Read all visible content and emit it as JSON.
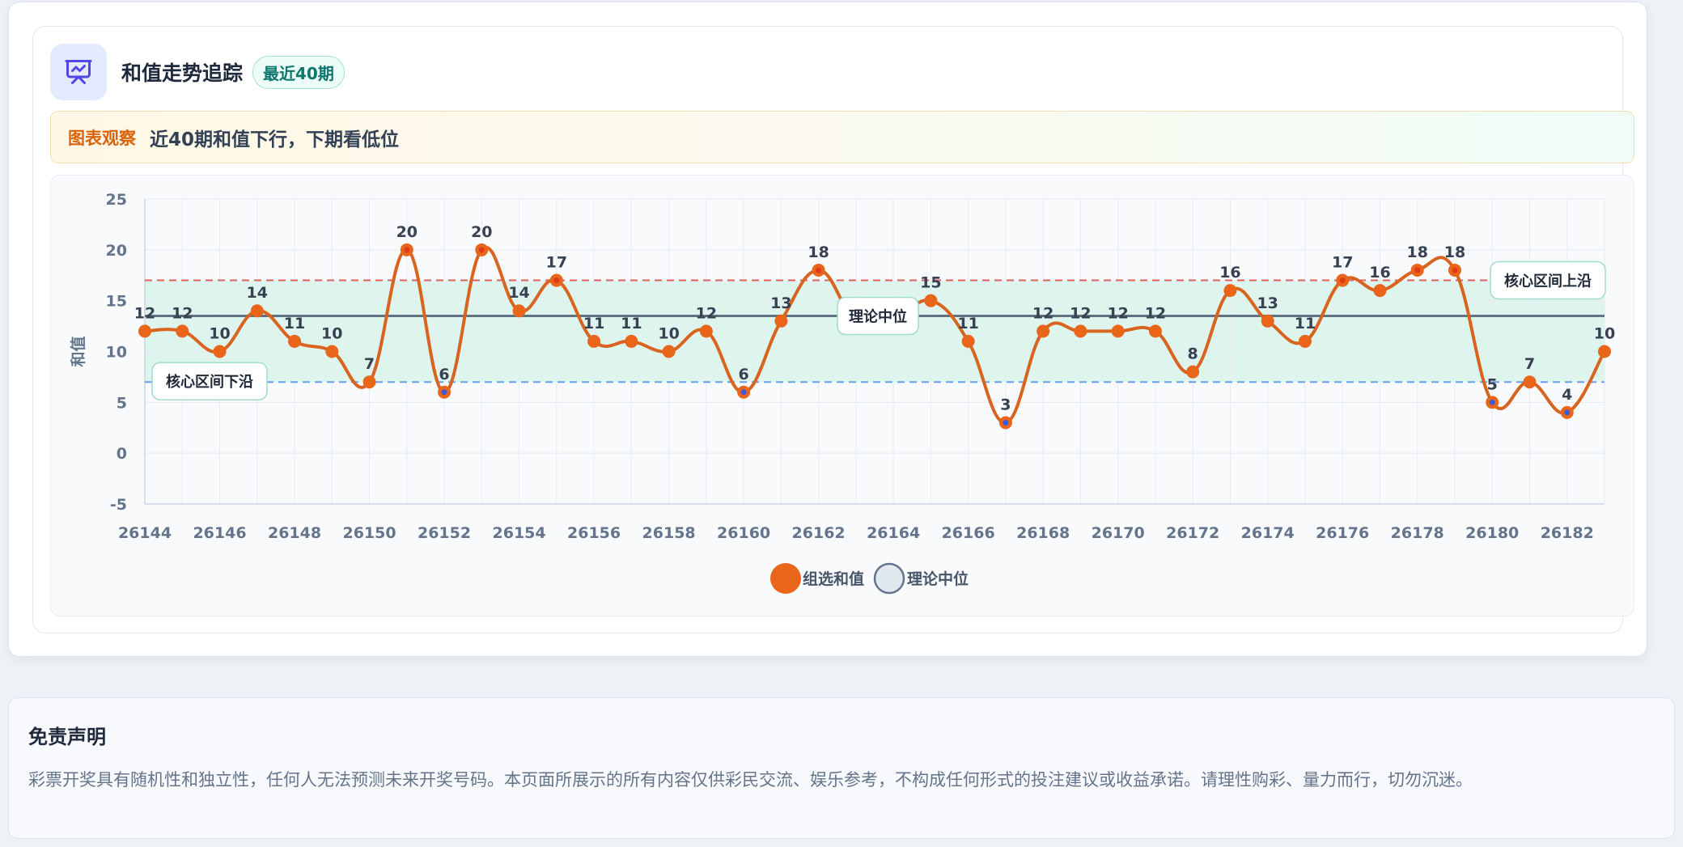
{
  "header": {
    "title": "和值走势追踪",
    "badge": "最近40期"
  },
  "observation": {
    "label": "图表观察",
    "text": "近40期和值下行，下期看低位"
  },
  "colors": {
    "series": "#e8651a",
    "series_stroke": "#d96420",
    "median": "#4b5a6e",
    "upper": "#e06060",
    "lower": "#6a9ee8",
    "band": "#d6f3ea",
    "low_dot": "#3c5bd8",
    "high_dot": "#e03a1a"
  },
  "chart_data": {
    "type": "line",
    "x": [
      26144,
      26145,
      26146,
      26147,
      26148,
      26149,
      26150,
      26151,
      26152,
      26153,
      26154,
      26155,
      26156,
      26157,
      26158,
      26159,
      26160,
      26161,
      26162,
      26163,
      26164,
      26165,
      26166,
      26167,
      26168,
      26169,
      26170,
      26171,
      26172,
      26173,
      26174,
      26175,
      26176,
      26177,
      26178,
      26179,
      26180,
      26181,
      26182,
      26183
    ],
    "x_ticks": [
      26144,
      26146,
      26148,
      26150,
      26152,
      26154,
      26156,
      26158,
      26160,
      26162,
      26164,
      26166,
      26168,
      26170,
      26172,
      26174,
      26176,
      26178,
      26180,
      26182
    ],
    "series": [
      {
        "name": "组选和值",
        "values": [
          12,
          12,
          10,
          14,
          11,
          10,
          7,
          20,
          6,
          20,
          14,
          17,
          11,
          11,
          10,
          12,
          6,
          13,
          18,
          13,
          13,
          15,
          11,
          3,
          12,
          12,
          12,
          12,
          8,
          16,
          13,
          11,
          17,
          16,
          18,
          18,
          5,
          7,
          4,
          10
        ]
      }
    ],
    "median": {
      "name": "理论中位",
      "value": 13.5
    },
    "upper": {
      "label": "核心区间上沿",
      "value": 17
    },
    "lower": {
      "label": "核心区间下沿",
      "value": 7
    },
    "ylabel": "和值",
    "ylim": [
      -5,
      25
    ],
    "y_ticks": [
      -5,
      0,
      5,
      10,
      15,
      20,
      25
    ],
    "grid": true,
    "legend": "bottom-center"
  },
  "disclaimer": {
    "title": "免责声明",
    "text": "彩票开奖具有随机性和独立性，任何人无法预测未来开奖号码。本页面所展示的所有内容仅供彩民交流、娱乐参考，不构成任何形式的投注建议或收益承诺。请理性购彩、量力而行，切勿沉迷。"
  }
}
